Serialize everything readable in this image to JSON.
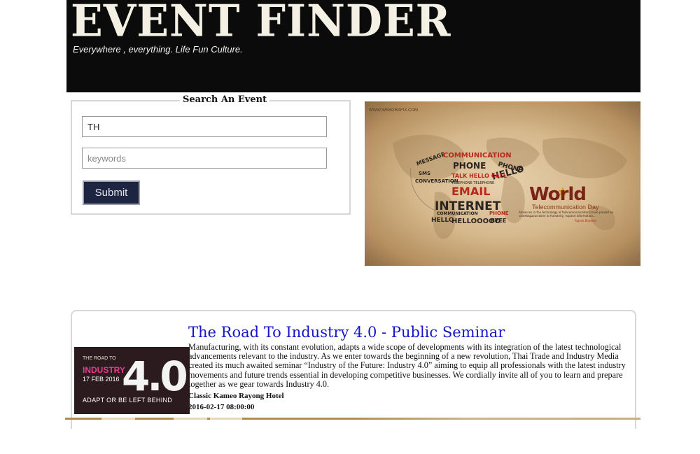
{
  "header": {
    "logo": "EVENT FINDER",
    "tagline": "Everywhere , everything.  Life Fun Culture."
  },
  "search": {
    "legend": "Search An Event",
    "location_value": "TH",
    "keywords_placeholder": "keywords",
    "submit_label": "Submit"
  },
  "banner": {
    "brand": "WWW.WEBGRAFIX.COM",
    "words": [
      "MESSAGE",
      "COMMUNICATION",
      "PHONE",
      "SMS",
      "CONVERSATION",
      "PHONE",
      "HELLO",
      "TALK",
      "HELLO",
      "CALL",
      "TELEPHONE",
      "EMAIL",
      "INTERNET",
      "COMMUNICATION",
      "BYE",
      "HELLO",
      "HELLOOOOO",
      "PHONE",
      "TEXT"
    ],
    "title": "World",
    "subtitle": "Telecommunication Day",
    "colors": {
      "accent": "#7a2418",
      "word_dark": "#2b2420",
      "word_red": "#b62a1d",
      "parchment": "#d6b98d"
    }
  },
  "event": {
    "title": "The Road To Industry 4.0 - Public Seminar",
    "description": "Manufacturing, with its constant evolution, adapts a wide scope of developments with its integration of the latest technological advancements relevant to the industry. As we enter towards the beginning of a new revolution, Thai Trade and Industry Media created its much awaited seminar “Industry of the Future: Industry 4.0” aiming to equip all professionals with the latest industry movements and future trends essential in developing competitive businesses. We cordially invite all of you to learn and prepare together as we gear towards Industry 4.0.",
    "venue": "Classic Kameo Rayong Hotel",
    "datetime": "2016-02-17 08:00:00",
    "thumbnail": {
      "small_text": "THE ROAD TO",
      "industry": "INDUSTRY",
      "number": "4.0",
      "date": "17 FEB 2016",
      "tagline": "ADAPT OR BE LEFT BEHIND"
    }
  },
  "colors": {
    "header_bg": "#0b0b0b",
    "title_link": "#1515c9",
    "button_bg": "#1d2540",
    "border": "#d7d7d7"
  }
}
